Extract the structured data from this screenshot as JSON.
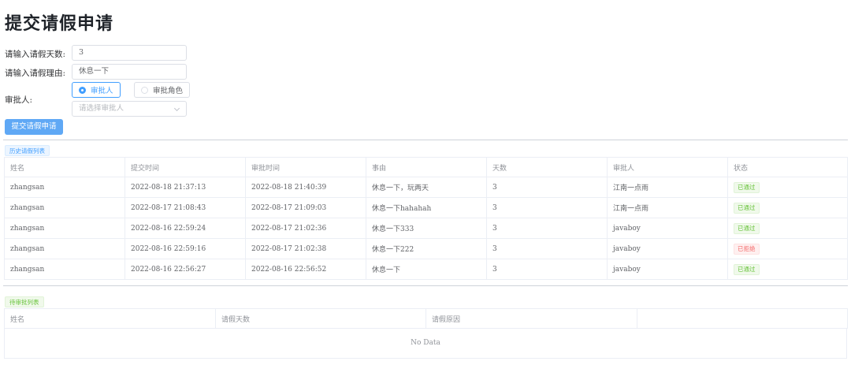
{
  "page": {
    "title": "提交请假申请"
  },
  "form": {
    "days_label": "请输入请假天数:",
    "days_value": "3",
    "reason_label": "请输入请假理由:",
    "reason_value": "休息一下",
    "approver_label": "审批人:",
    "radio_options": [
      {
        "label": "审批人",
        "selected": true
      },
      {
        "label": "审批角色",
        "selected": false
      }
    ],
    "select_placeholder": "请选择审批人",
    "submit_label": "提交请假申请"
  },
  "history": {
    "tag": "历史请假列表",
    "columns": [
      "姓名",
      "提交时间",
      "审批时间",
      "事由",
      "天数",
      "审批人",
      "状态"
    ],
    "rows": [
      {
        "name": "zhangsan",
        "submit_time": "2022-08-18 21:37:13",
        "approve_time": "2022-08-18 21:40:39",
        "reason": "休息一下，玩两天",
        "days": "3",
        "approver": "江南一点雨",
        "status": "已通过",
        "status_type": "ok"
      },
      {
        "name": "zhangsan",
        "submit_time": "2022-08-17 21:08:43",
        "approve_time": "2022-08-17 21:09:03",
        "reason": "休息一下hahahah",
        "days": "3",
        "approver": "江南一点雨",
        "status": "已通过",
        "status_type": "ok"
      },
      {
        "name": "zhangsan",
        "submit_time": "2022-08-16 22:59:24",
        "approve_time": "2022-08-17 21:02:36",
        "reason": "休息一下333",
        "days": "3",
        "approver": "javaboy",
        "status": "已通过",
        "status_type": "ok"
      },
      {
        "name": "zhangsan",
        "submit_time": "2022-08-16 22:59:16",
        "approve_time": "2022-08-17 21:02:38",
        "reason": "休息一下222",
        "days": "3",
        "approver": "javaboy",
        "status": "已拒绝",
        "status_type": "no"
      },
      {
        "name": "zhangsan",
        "submit_time": "2022-08-16 22:56:27",
        "approve_time": "2022-08-16 22:56:52",
        "reason": "休息一下",
        "days": "3",
        "approver": "javaboy",
        "status": "已通过",
        "status_type": "ok"
      }
    ]
  },
  "pending": {
    "tag": "待审批列表",
    "columns": [
      "姓名",
      "请假天数",
      "请假原因",
      ""
    ],
    "empty_text": "No Data"
  },
  "colors": {
    "primary": "#409eff",
    "success": "#67c23a",
    "danger": "#f56c6c",
    "submit_button": "#5fa8f5"
  }
}
